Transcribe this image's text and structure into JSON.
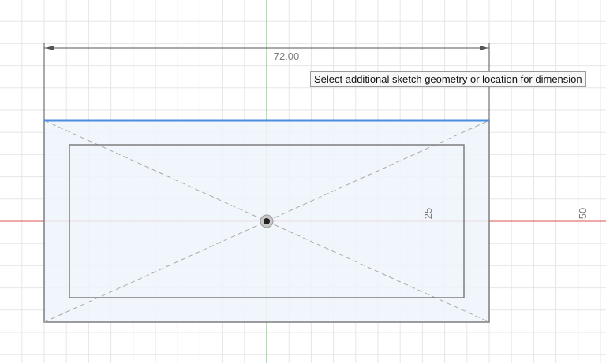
{
  "sketch": {
    "horizontal_dimension": "72.00",
    "vertical_label_inner": "25",
    "vertical_label_outer": "50"
  },
  "tooltip": {
    "text": "Select additional sketch geometry or location for dimension"
  },
  "colors": {
    "selected_line": "#4a8ee0",
    "x_axis": "#d9534f",
    "y_axis": "#6fd36f",
    "grid": "#e6e6e6",
    "profile_fill": "#eef5fc"
  }
}
